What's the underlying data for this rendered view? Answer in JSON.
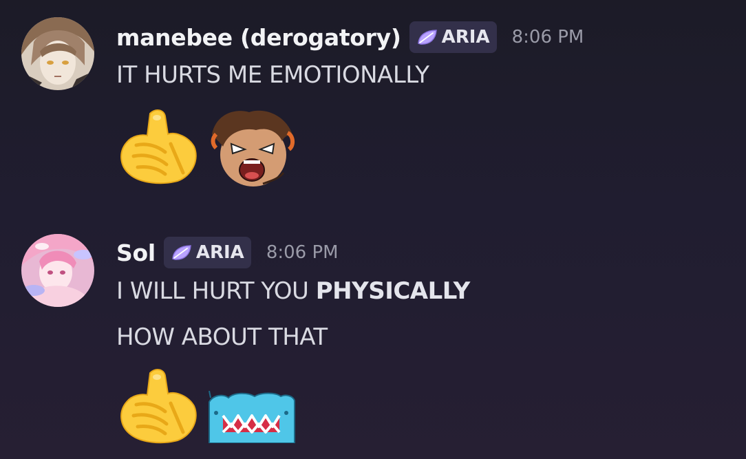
{
  "messages": [
    {
      "username": "manebee (derogatory)",
      "tag": "ARIA",
      "time": "8:06 PM",
      "lines": [
        "IT HURTS ME EMOTIONALLY"
      ],
      "emojis": [
        "pointing-hand-emoji",
        "screaming-character-emoji"
      ]
    },
    {
      "username": "Sol",
      "tag": "ARIA",
      "time": "8:06 PM",
      "line1_plain": "I WILL HURT YOU ",
      "line1_bold": "PHYSICALLY",
      "line2": "HOW ABOUT THAT",
      "emojis": [
        "pointing-hand-emoji",
        "blue-monster-emoji"
      ]
    }
  ],
  "colors": {
    "background": "#201d30",
    "username": "#f2f3f5",
    "tag_bg": "#33304a",
    "tag_leaf": "#b9a3ff",
    "timestamp": "#9a9ba8",
    "message_text": "#d9dae2"
  }
}
